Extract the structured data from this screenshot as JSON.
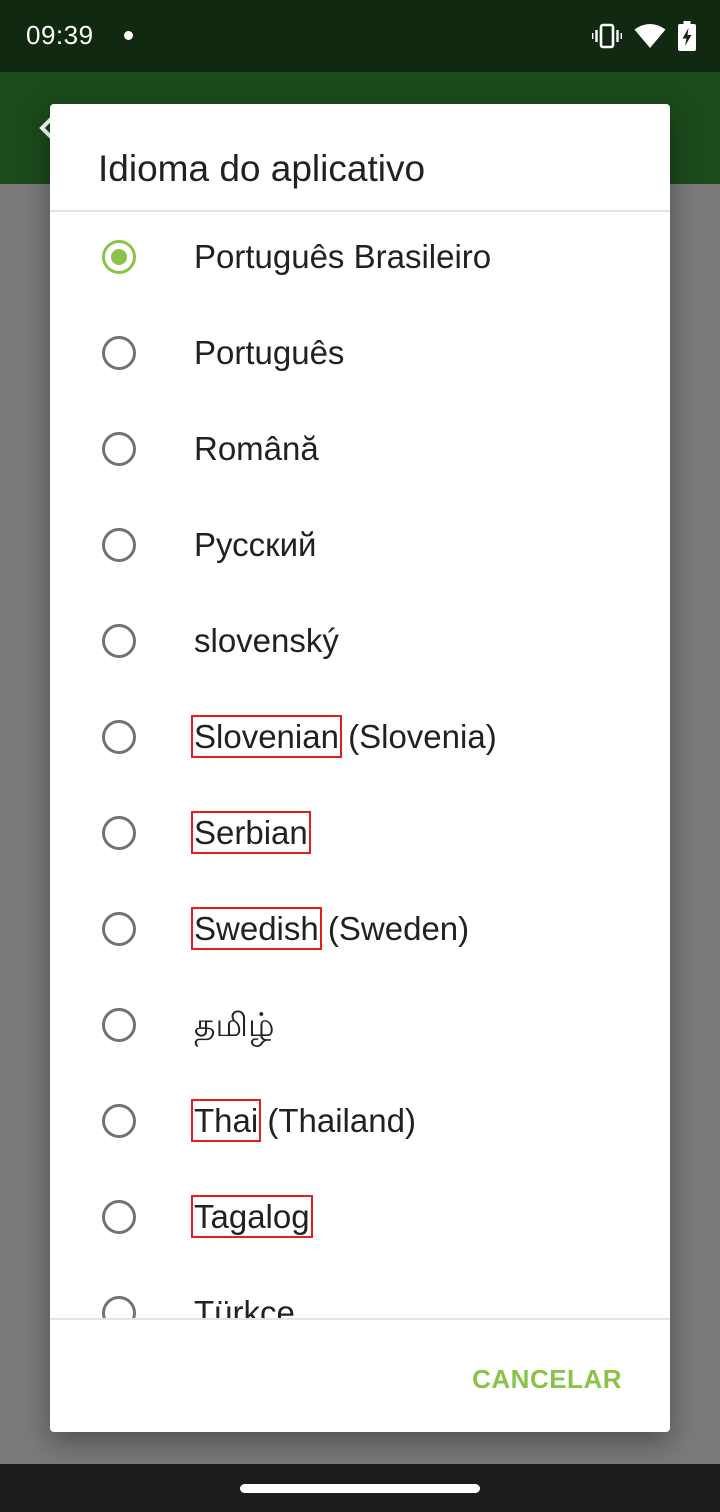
{
  "status_bar": {
    "time": "09:39",
    "icons": [
      "notification-dot-icon",
      "vibrate-icon",
      "wifi-icon",
      "battery-charging-icon"
    ]
  },
  "app_bar": {
    "background_color": "#1b4a1b",
    "back_icon": "back-arrow-icon"
  },
  "dialog": {
    "title": "Idioma do aplicativo",
    "accent_color": "#8bc34a",
    "options": [
      {
        "label": "Português Brasileiro",
        "selected": true
      },
      {
        "label": "Português",
        "selected": false
      },
      {
        "label": "Română",
        "selected": false
      },
      {
        "label": "Русский",
        "selected": false
      },
      {
        "label": "slovenský",
        "selected": false
      },
      {
        "marked": "Slovenian",
        "rest": " (Slovenia)",
        "selected": false
      },
      {
        "marked": "Serbian",
        "rest": "",
        "selected": false
      },
      {
        "marked": "Swedish",
        "rest": " (Sweden)",
        "selected": false
      },
      {
        "label": "தமிழ்",
        "selected": false
      },
      {
        "marked": "Thai",
        "rest": " (Thailand)",
        "selected": false
      },
      {
        "marked": "Tagalog",
        "rest": "",
        "selected": false
      },
      {
        "label": "Türkçe",
        "selected": false
      }
    ],
    "cancel_label": "CANCELAR"
  }
}
